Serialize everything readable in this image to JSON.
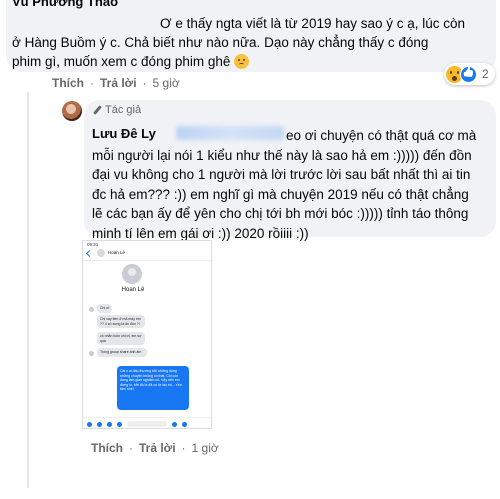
{
  "top_comment": {
    "author": "Vũ Phương Thảo",
    "text_line1": "Ơ e thấy ngta viết là từ 2019 hay sao ý c ạ, lúc còn",
    "text_line2": "ở Hàng Buồm ý c. Chả biết như nào nữa. Dạo này chẳng thấy c đóng",
    "text_line3": "phim gì, muốn xem c đóng phim ghê",
    "emoji": "sad-face-emoji",
    "actions": {
      "like": "Thích",
      "reply": "Trả lời",
      "time": "5 giờ"
    },
    "reactions": {
      "icons": [
        "wow-icon",
        "like-icon"
      ],
      "count": "2"
    }
  },
  "reply": {
    "badge": "Tác giả",
    "author": "Lưu Đê Ly",
    "text_line1": "eo ơi chuyện có thật quá cơ mà",
    "text_line2": "mỗi người lại nói 1 kiểu như thế này là sao hả em :))))) đến đồn",
    "text_line3": "đại vu không cho 1 người mà lời trước lời sau bất nhất thì ai tin",
    "text_line4": "đc hả em??? :)) em nghĩ gì mà chuyện 2019 nếu có thật chẳng",
    "text_line5": "lẽ các bạn ấy để yên cho chị tới bh mới bóc :))))) tỉnh táo thông",
    "text_line6": "minh tí lên em gái ơi :)) 2020 rồiiii :))",
    "actions": {
      "like": "Thích",
      "reply": "Trả lời",
      "time": "1 giờ"
    }
  },
  "phone_screenshot": {
    "status_time": "09:31",
    "contact_name": "Hoan Lê",
    "header_name": "Hoan Lê",
    "msg1": "Chị ơi",
    "msg2": "Chị vay tiền ở mã mấy em ?? 4 cô xưng là ăn đòn ?!",
    "msg3": "có nhắn luôn chị ơi, em sợ quá",
    "msg4": "Trong group share ảnh ấm",
    "msg_right": "Cái x ai đấu thương bởi những dòng những chuyện không có thật. Chị còn đang làm gian nghiệm cũ. Vậy nên em đừng lo, bởi đó là đã có từ lâu rồi... Yên tâm nhé!"
  },
  "colors": {
    "bubble": "#f0f2f5",
    "meta": "#65676b",
    "accent": "#1877f2"
  }
}
